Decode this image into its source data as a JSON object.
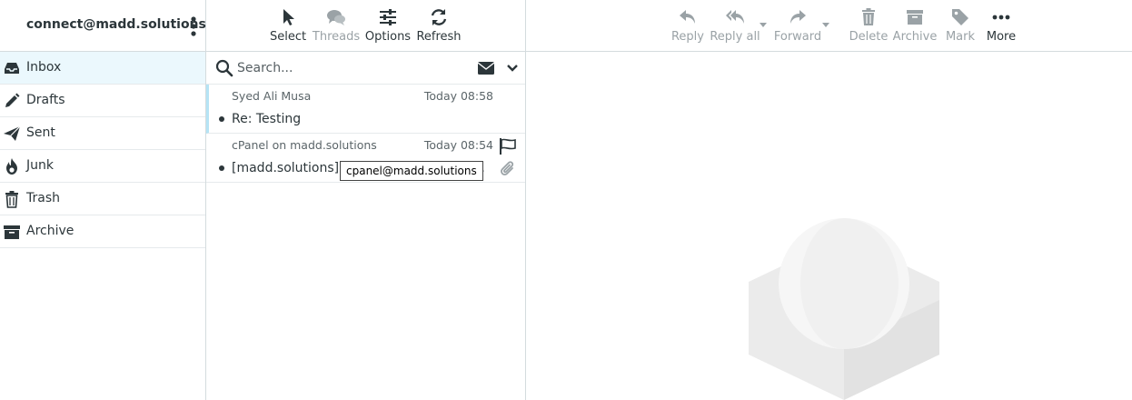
{
  "account": {
    "email": "connect@madd.solutions"
  },
  "folders": [
    {
      "label": "Inbox",
      "icon": "inbox-icon",
      "active": true
    },
    {
      "label": "Drafts",
      "icon": "pencil-icon"
    },
    {
      "label": "Sent",
      "icon": "paper-plane-icon"
    },
    {
      "label": "Junk",
      "icon": "fire-icon"
    },
    {
      "label": "Trash",
      "icon": "trash-icon"
    },
    {
      "label": "Archive",
      "icon": "archive-icon"
    }
  ],
  "list_toolbar": {
    "select": "Select",
    "threads": "Threads",
    "options": "Options",
    "refresh": "Refresh"
  },
  "search": {
    "placeholder": "Search..."
  },
  "messages": [
    {
      "from": "Syed Ali Musa",
      "date": "Today 08:58",
      "subject": "Re: Testing",
      "unread": true
    },
    {
      "from": "cPanel on madd.solutions",
      "date": "Today 08:54",
      "subject": "[madd.solutions] Client configuration settings for “connect@madd.solutions”",
      "unread": true,
      "flag": true,
      "attachment": true
    }
  ],
  "tooltip": "cpanel@madd.solutions",
  "message_toolbar": {
    "reply": "Reply",
    "reply_all": "Reply all",
    "forward": "Forward",
    "delete": "Delete",
    "archive": "Archive",
    "mark": "Mark",
    "more": "More"
  },
  "colors": {
    "active_folder_bg": "#ebf8fd",
    "selected_marker": "#b6e4f5",
    "disabled_text": "#9aa2a6",
    "text": "#2c363a"
  }
}
